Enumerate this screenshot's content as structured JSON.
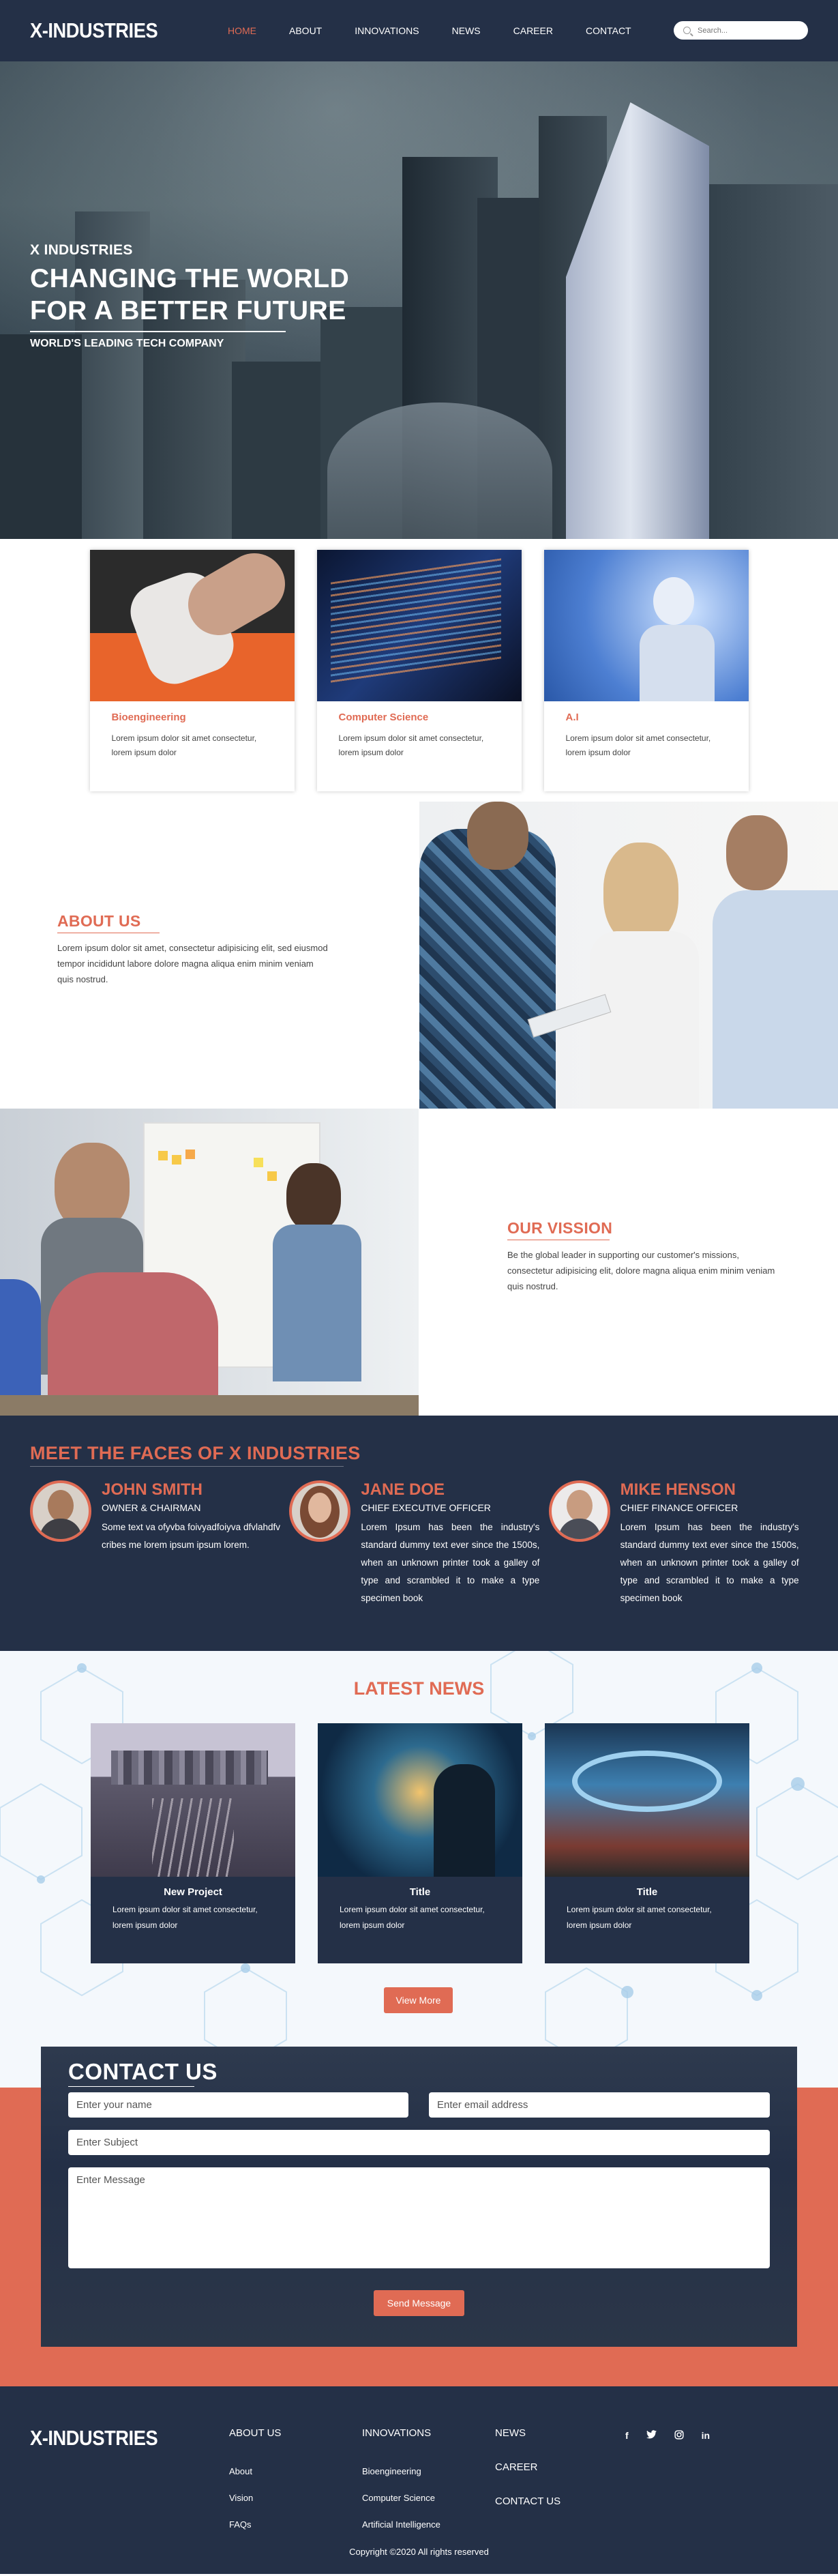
{
  "header": {
    "logo": "X-INDUSTRIES",
    "nav": [
      "HOME",
      "ABOUT",
      "INNOVATIONS",
      "NEWS",
      "CAREER",
      "CONTACT"
    ],
    "search_placeholder": "Search..."
  },
  "hero": {
    "kicker": "X INDUSTRIES",
    "title_line1": "CHANGING THE WORLD",
    "title_line2": "FOR A BETTER FUTURE",
    "subtitle": "WORLD'S LEADING TECH COMPANY"
  },
  "innovations": [
    {
      "title": "Bioengineering",
      "line1": "Lorem ipsum dolor sit amet consectetur,",
      "line2": "lorem ipsum dolor"
    },
    {
      "title": "Computer Science",
      "line1": "Lorem ipsum dolor sit amet consectetur,",
      "line2": "lorem ipsum dolor"
    },
    {
      "title": "A.I",
      "line1": "Lorem ipsum dolor sit amet consectetur,",
      "line2": "lorem ipsum dolor"
    }
  ],
  "about": {
    "title": "ABOUT US",
    "body": "Lorem ipsum dolor sit amet, consectetur adipisicing elit, sed eiusmod tempor incididunt labore dolore magna aliqua enim minim veniam quis nostrud."
  },
  "vision": {
    "title": "OUR VISSION",
    "body": "Be the global leader in supporting our customer's missions, consectetur adipisicing elit, dolore magna aliqua enim minim veniam quis nostrud."
  },
  "team": {
    "title": "MEET THE FACES OF X INDUSTRIES",
    "members": [
      {
        "name": "JOHN SMITH",
        "role": "OWNER & CHAIRMAN",
        "bio": "Some text va ofyvba foivyadfoiyva dfvlahdfv cribes me lorem ipsum ipsum lorem."
      },
      {
        "name": "JANE DOE",
        "role": "CHIEF EXECUTIVE OFFICER",
        "bio": "Lorem Ipsum has been the industry's standard dummy text ever since the 1500s, when an unknown printer took a galley of type and scrambled it to make a type specimen book"
      },
      {
        "name": "MIKE HENSON",
        "role": "CHIEF FINANCE OFFICER",
        "bio": "Lorem Ipsum has been the industry's standard dummy text ever since the 1500s, when an unknown printer took a galley of type and scrambled it to make a type specimen book"
      }
    ]
  },
  "news": {
    "title": "LATEST NEWS",
    "items": [
      {
        "title": "New Project",
        "line1": "Lorem ipsum dolor sit amet consectetur,",
        "line2": "lorem ipsum dolor"
      },
      {
        "title": "Title",
        "line1": "Lorem ipsum dolor sit amet consectetur,",
        "line2": "lorem ipsum dolor"
      },
      {
        "title": "Title",
        "line1": "Lorem ipsum dolor sit amet consectetur,",
        "line2": "lorem ipsum dolor"
      }
    ],
    "view_more": "View More"
  },
  "contact": {
    "title": "CONTACT US",
    "name_placeholder": "Enter your name",
    "email_placeholder": "Enter email address",
    "subject_placeholder": "Enter Subject",
    "message_placeholder": "Enter Message",
    "send": "Send Message"
  },
  "footer": {
    "logo": "X-INDUSTRIES",
    "about": {
      "head": "ABOUT US",
      "links": [
        "About",
        "Vision",
        "FAQs"
      ]
    },
    "innovations": {
      "head": "INNOVATIONS",
      "links": [
        "Bioengineering",
        "Computer Science",
        "Artificial Intelligence"
      ]
    },
    "news": {
      "links": [
        "NEWS",
        "CAREER",
        "CONTACT US"
      ]
    },
    "social": [
      "f",
      "twitter",
      "instagram",
      "in"
    ],
    "copyright": "Copyright ©2020 All rights reserved"
  },
  "colors": {
    "navy": "#243047",
    "accent": "#e06b54"
  }
}
